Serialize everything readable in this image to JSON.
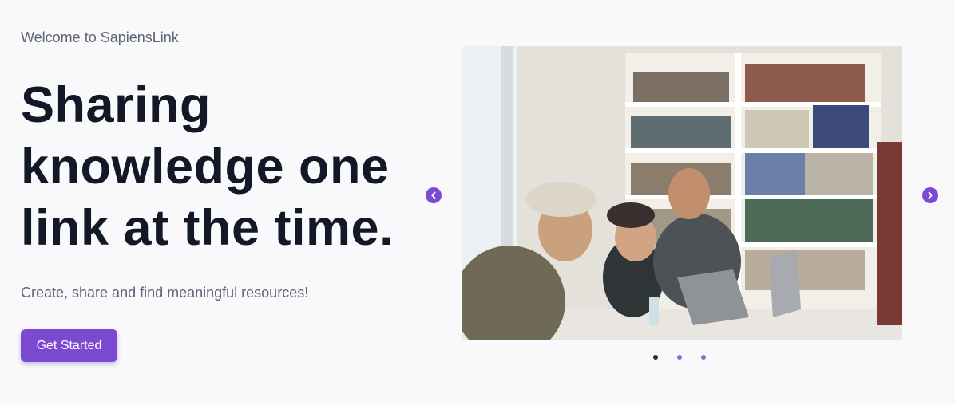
{
  "hero": {
    "welcome": "Welcome to SapiensLink",
    "headline": "Sharing knowledge one link at the time.",
    "subtitle": "Create, share and find meaningful resources!",
    "cta_label": "Get Started"
  },
  "carousel": {
    "slide_count": 3,
    "active_index": 0,
    "prev_icon": "chevron-left-icon",
    "next_icon": "chevron-right-icon",
    "image_subject": "photo"
  },
  "colors": {
    "accent": "#7b4ad1",
    "heading": "#131826",
    "muted_text": "#5b6478",
    "background": "#f9f9fb",
    "dot_active": "#2b2b2b",
    "dot_inactive": "#8a6fd6"
  }
}
